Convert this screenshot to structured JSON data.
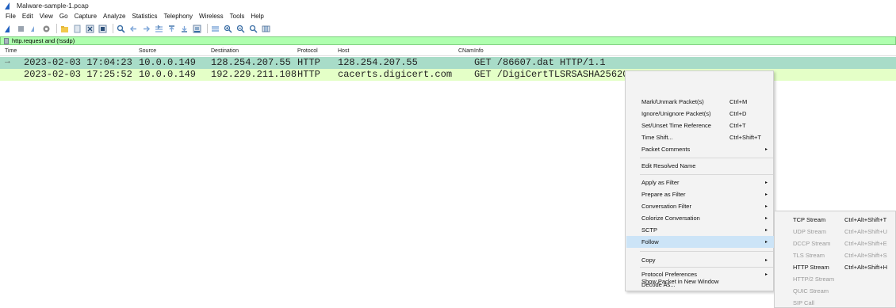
{
  "window": {
    "title": "Malware-sample-1.pcap"
  },
  "menubar": [
    "File",
    "Edit",
    "View",
    "Go",
    "Capture",
    "Analyze",
    "Statistics",
    "Telephony",
    "Wireless",
    "Tools",
    "Help"
  ],
  "filter": {
    "value": "http.request and (!ssdp)"
  },
  "columns": {
    "time": "Time",
    "source": "Source",
    "destination": "Destination",
    "protocol": "Protocol",
    "host": "Host",
    "cname": "CNam",
    "info": "Info"
  },
  "packets": [
    {
      "time": "2023-02-03 17:04:23",
      "source": "10.0.0.149",
      "destination": "128.254.207.55",
      "protocol": "HTTP",
      "host": "128.254.207.55",
      "info": "GET /86607.dat HTTP/1.1"
    },
    {
      "time": "2023-02-03 17:25:52",
      "source": "10.0.0.149",
      "destination": "192.229.211.108",
      "protocol": "HTTP",
      "host": "cacerts.digicert.com",
      "info": "GET /DigiCertTLSRSASHA25620"
    }
  ],
  "context_menu": {
    "items": [
      {
        "label": "Mark/Unmark Packet(s)",
        "shortcut": "Ctrl+M"
      },
      {
        "label": "Ignore/Unignore Packet(s)",
        "shortcut": "Ctrl+D"
      },
      {
        "label": "Set/Unset Time Reference",
        "shortcut": "Ctrl+T"
      },
      {
        "label": "Time Shift...",
        "shortcut": "Ctrl+Shift+T"
      },
      {
        "label": "Packet Comments",
        "arrow": "▸"
      },
      {
        "label": "Edit Resolved Name"
      },
      {
        "label": "Apply as Filter",
        "arrow": "▸"
      },
      {
        "label": "Prepare as Filter",
        "arrow": "▸"
      },
      {
        "label": "Conversation Filter",
        "arrow": "▸"
      },
      {
        "label": "Colorize Conversation",
        "arrow": "▸"
      },
      {
        "label": "SCTP",
        "arrow": "▸"
      },
      {
        "label": "Follow",
        "arrow": "▸"
      },
      {
        "label": "Copy",
        "arrow": "▸"
      },
      {
        "label": "Protocol Preferences",
        "arrow": "▸"
      },
      {
        "label": "Decode As..."
      },
      {
        "label": "Show Packet in New Window"
      }
    ]
  },
  "follow_submenu": {
    "items": [
      {
        "label": "TCP Stream",
        "shortcut": "Ctrl+Alt+Shift+T"
      },
      {
        "label": "UDP Stream",
        "shortcut": "Ctrl+Alt+Shift+U"
      },
      {
        "label": "DCCP Stream",
        "shortcut": "Ctrl+Alt+Shift+E"
      },
      {
        "label": "TLS Stream",
        "shortcut": "Ctrl+Alt+Shift+S"
      },
      {
        "label": "HTTP Stream",
        "shortcut": "Ctrl+Alt+Shift+H"
      },
      {
        "label": "HTTP/2 Stream"
      },
      {
        "label": "QUIC Stream"
      },
      {
        "label": "SIP Call"
      }
    ]
  },
  "colors": {
    "filter_bg": "#afffaf",
    "selected_row": "#a8dcc8",
    "http_row": "#e4ffc7",
    "menu_highlight": "#cce4f7",
    "shark_fin": "#1f5fbf"
  }
}
